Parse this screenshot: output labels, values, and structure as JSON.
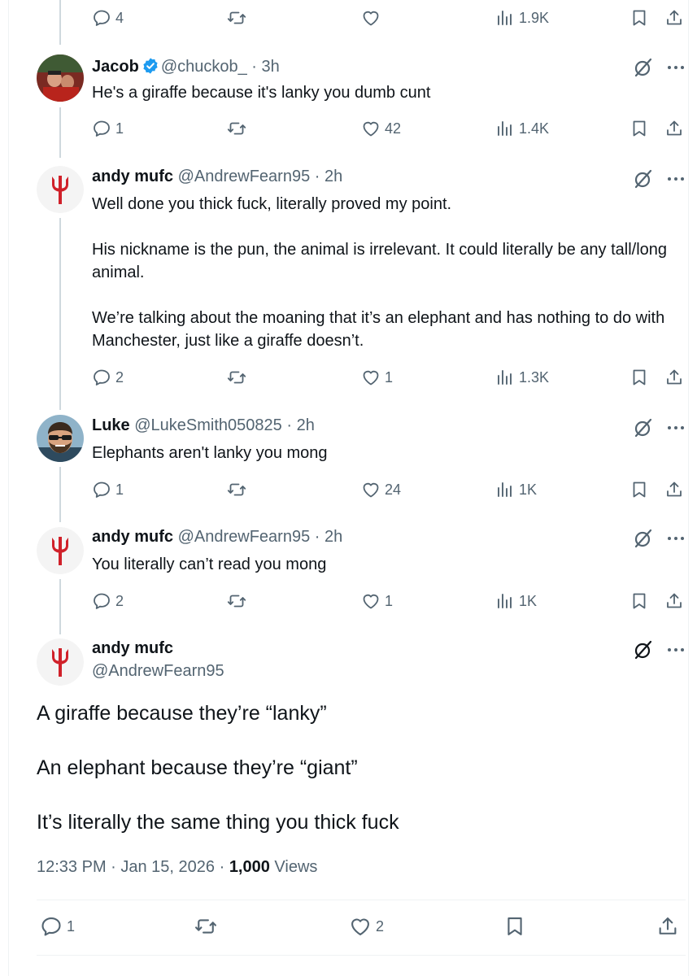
{
  "top_actions": {
    "replies": "4",
    "likes": "",
    "views": "1.9K"
  },
  "replies": [
    {
      "name": "Jacob",
      "handle": "@chuckob_",
      "time": "· 3h",
      "lines": [
        "He's a giraffe because it's lanky you dumb cunt"
      ],
      "actions": {
        "replies": "1",
        "likes": "42",
        "views": "1.4K"
      }
    },
    {
      "name": "andy mufc",
      "handle": "@AndrewFearn95",
      "time": "· 2h",
      "paragraphs": [
        "Well done you thick fuck, literally proved my point.",
        "His nickname is the pun, the animal is irrelevant. It could literally be any tall/long animal.",
        "We’re talking about the moaning that it’s an elephant and has nothing to do with Manchester, just like a giraffe doesn’t."
      ],
      "actions": {
        "replies": "2",
        "likes": "1",
        "views": "1.3K"
      }
    },
    {
      "name": "Luke",
      "handle": "@LukeSmith050825",
      "time": "· 2h",
      "lines": [
        "Elephants aren't lanky you mong"
      ],
      "actions": {
        "replies": "1",
        "likes": "24",
        "views": "1K"
      }
    },
    {
      "name": "andy mufc",
      "handle": "@AndrewFearn95",
      "time": "· 2h",
      "lines": [
        "You literally can’t read you mong"
      ],
      "actions": {
        "replies": "2",
        "likes": "1",
        "views": "1K"
      }
    }
  ],
  "main_tweet": {
    "name": "andy mufc",
    "handle": "@AndrewFearn95",
    "paragraphs": [
      "A giraffe because they’re “lanky”",
      "An elephant because they’re “giant”",
      "It’s literally the same thing you thick fuck"
    ],
    "timestamp": "12:33 PM · Jan 15, 2026 · ",
    "views_count": "1,000",
    "views_label": " Views",
    "actions": {
      "replies": "1",
      "likes": "2"
    }
  },
  "colors": {
    "text": "#0f1419",
    "secondary": "#536471",
    "verified": "#1d9bf0",
    "thread_line": "#cfd9de",
    "trident": "#d0212a"
  },
  "icons": [
    "reply-icon",
    "retweet-icon",
    "like-icon",
    "views-icon",
    "bookmark-icon",
    "share-icon",
    "grok-icon",
    "more-icon",
    "verified-badge-icon",
    "trident-logo-icon"
  ]
}
